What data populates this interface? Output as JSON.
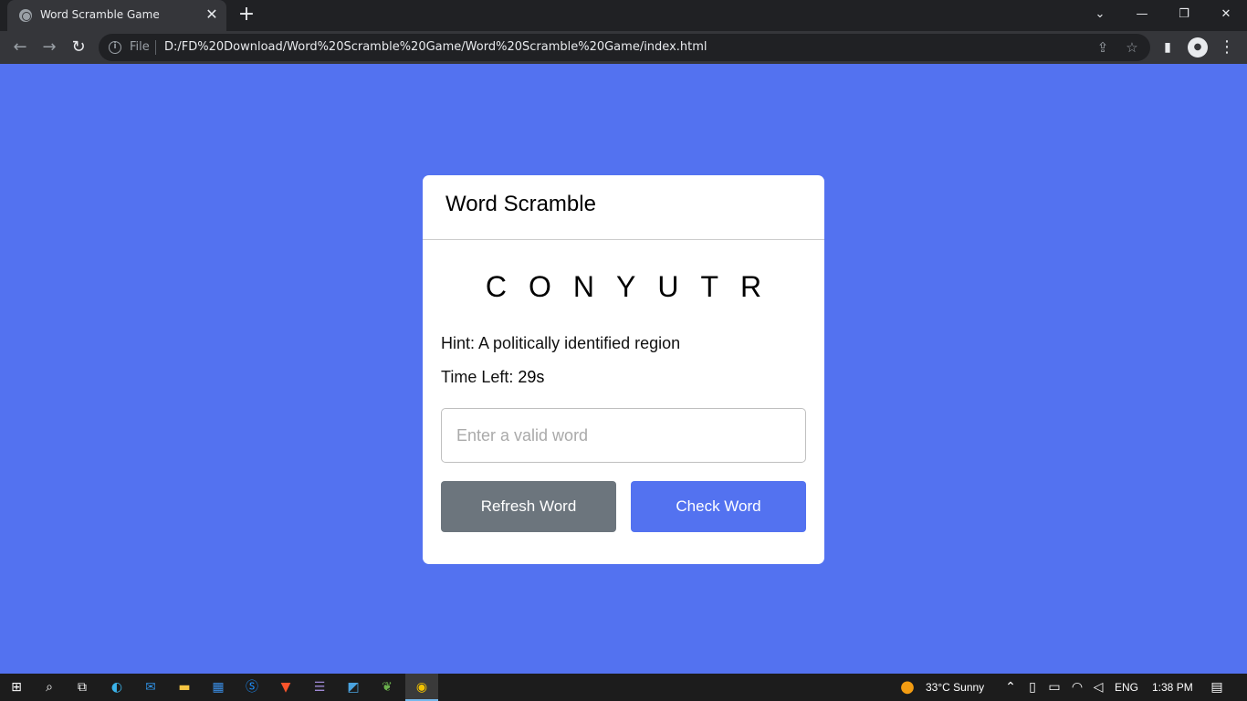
{
  "browser": {
    "tab_title": "Word Scramble Game",
    "tab_close": "✕",
    "new_tab": "+",
    "url_scheme": "File",
    "url": "D:/FD%20Download/Word%20Scramble%20Game/Word%20Scramble%20Game/index.html",
    "controls": {
      "tab_list": "⌄",
      "minimize": "—",
      "restore": "❐",
      "close": "✕"
    }
  },
  "game": {
    "title": "Word Scramble",
    "scrambled_word": "CONYUTR",
    "hint_label": "Hint:",
    "hint": "A politically identified region",
    "time_label": "Time Left:",
    "time_value": "29s",
    "input_placeholder": "Enter a valid word",
    "input_value": "",
    "refresh_button": "Refresh Word",
    "check_button": "Check Word"
  },
  "taskbar": {
    "weather": "33°C  Sunny",
    "language": "ENG",
    "time": "1:38 PM"
  },
  "colors": {
    "page_bg": "#5372f0",
    "refresh_btn": "#6c757d",
    "check_btn": "#5372f0"
  }
}
